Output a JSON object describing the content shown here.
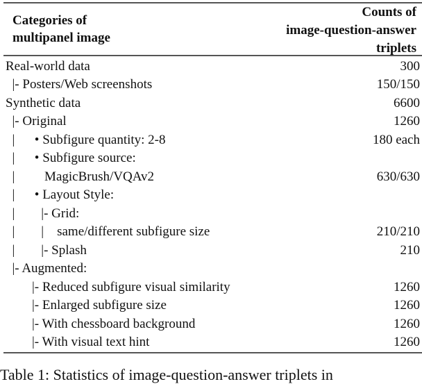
{
  "table": {
    "header": {
      "left_line1": "Categories of",
      "left_line2": "multipanel image",
      "right_line1": "Counts of",
      "right_line2": "image-question-answer",
      "right_line3": "triplets"
    },
    "rows": [
      {
        "label": "Real-world data",
        "value": "300"
      },
      {
        "label": "  |- Posters/Web screenshots",
        "value": "150/150"
      },
      {
        "label": "Synthetic data",
        "value": "6600"
      },
      {
        "label": "  |- Original",
        "value": "1260"
      },
      {
        "label": "  |      • Subfigure quantity: 2-8",
        "value": "180 each"
      },
      {
        "label": "  |      • Subfigure source:",
        "value": ""
      },
      {
        "label": "  |         MagicBrush/VQAv2",
        "value": "630/630"
      },
      {
        "label": "  |      • Layout Style:",
        "value": ""
      },
      {
        "label": "  |        |- Grid:",
        "value": ""
      },
      {
        "label": "  |        |    same/different subfigure size",
        "value": "210/210"
      },
      {
        "label": "  |        |- Splash",
        "value": "210"
      },
      {
        "label": "  |- Augmented:",
        "value": ""
      },
      {
        "label": "        |- Reduced subfigure visual similarity",
        "value": "1260"
      },
      {
        "label": "        |- Enlarged subfigure size",
        "value": "1260"
      },
      {
        "label": "        |- With chessboard background",
        "value": "1260"
      },
      {
        "label": "        |- With visual text hint",
        "value": "1260"
      }
    ]
  },
  "caption": "Table 1: Statistics of image-question-answer triplets in"
}
